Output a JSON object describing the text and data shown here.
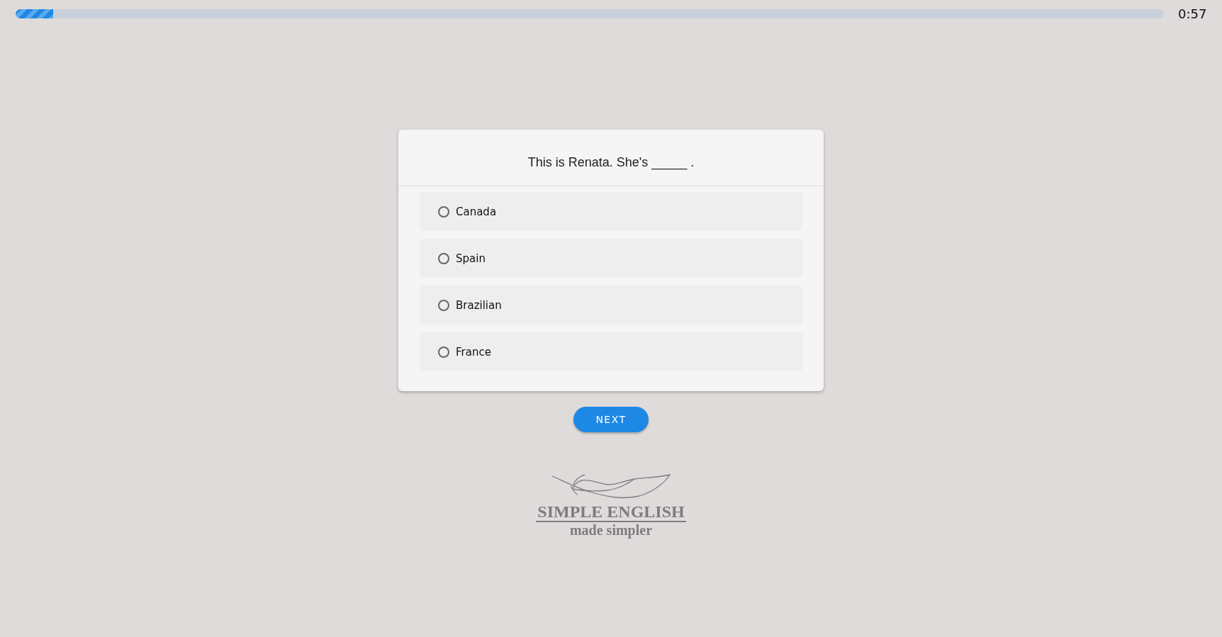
{
  "progress": {
    "level": 0.033
  },
  "timer": "0:57",
  "question": "This is Renata. She's _____ .",
  "options": [
    {
      "label": "Canada",
      "selected": false
    },
    {
      "label": "Spain",
      "selected": false
    },
    {
      "label": "Brazilian",
      "selected": false
    },
    {
      "label": "France",
      "selected": false
    }
  ],
  "next_button": "NEXT",
  "logo": {
    "title": "SIMPLE ENGLISH",
    "tagline": "made simpler"
  }
}
